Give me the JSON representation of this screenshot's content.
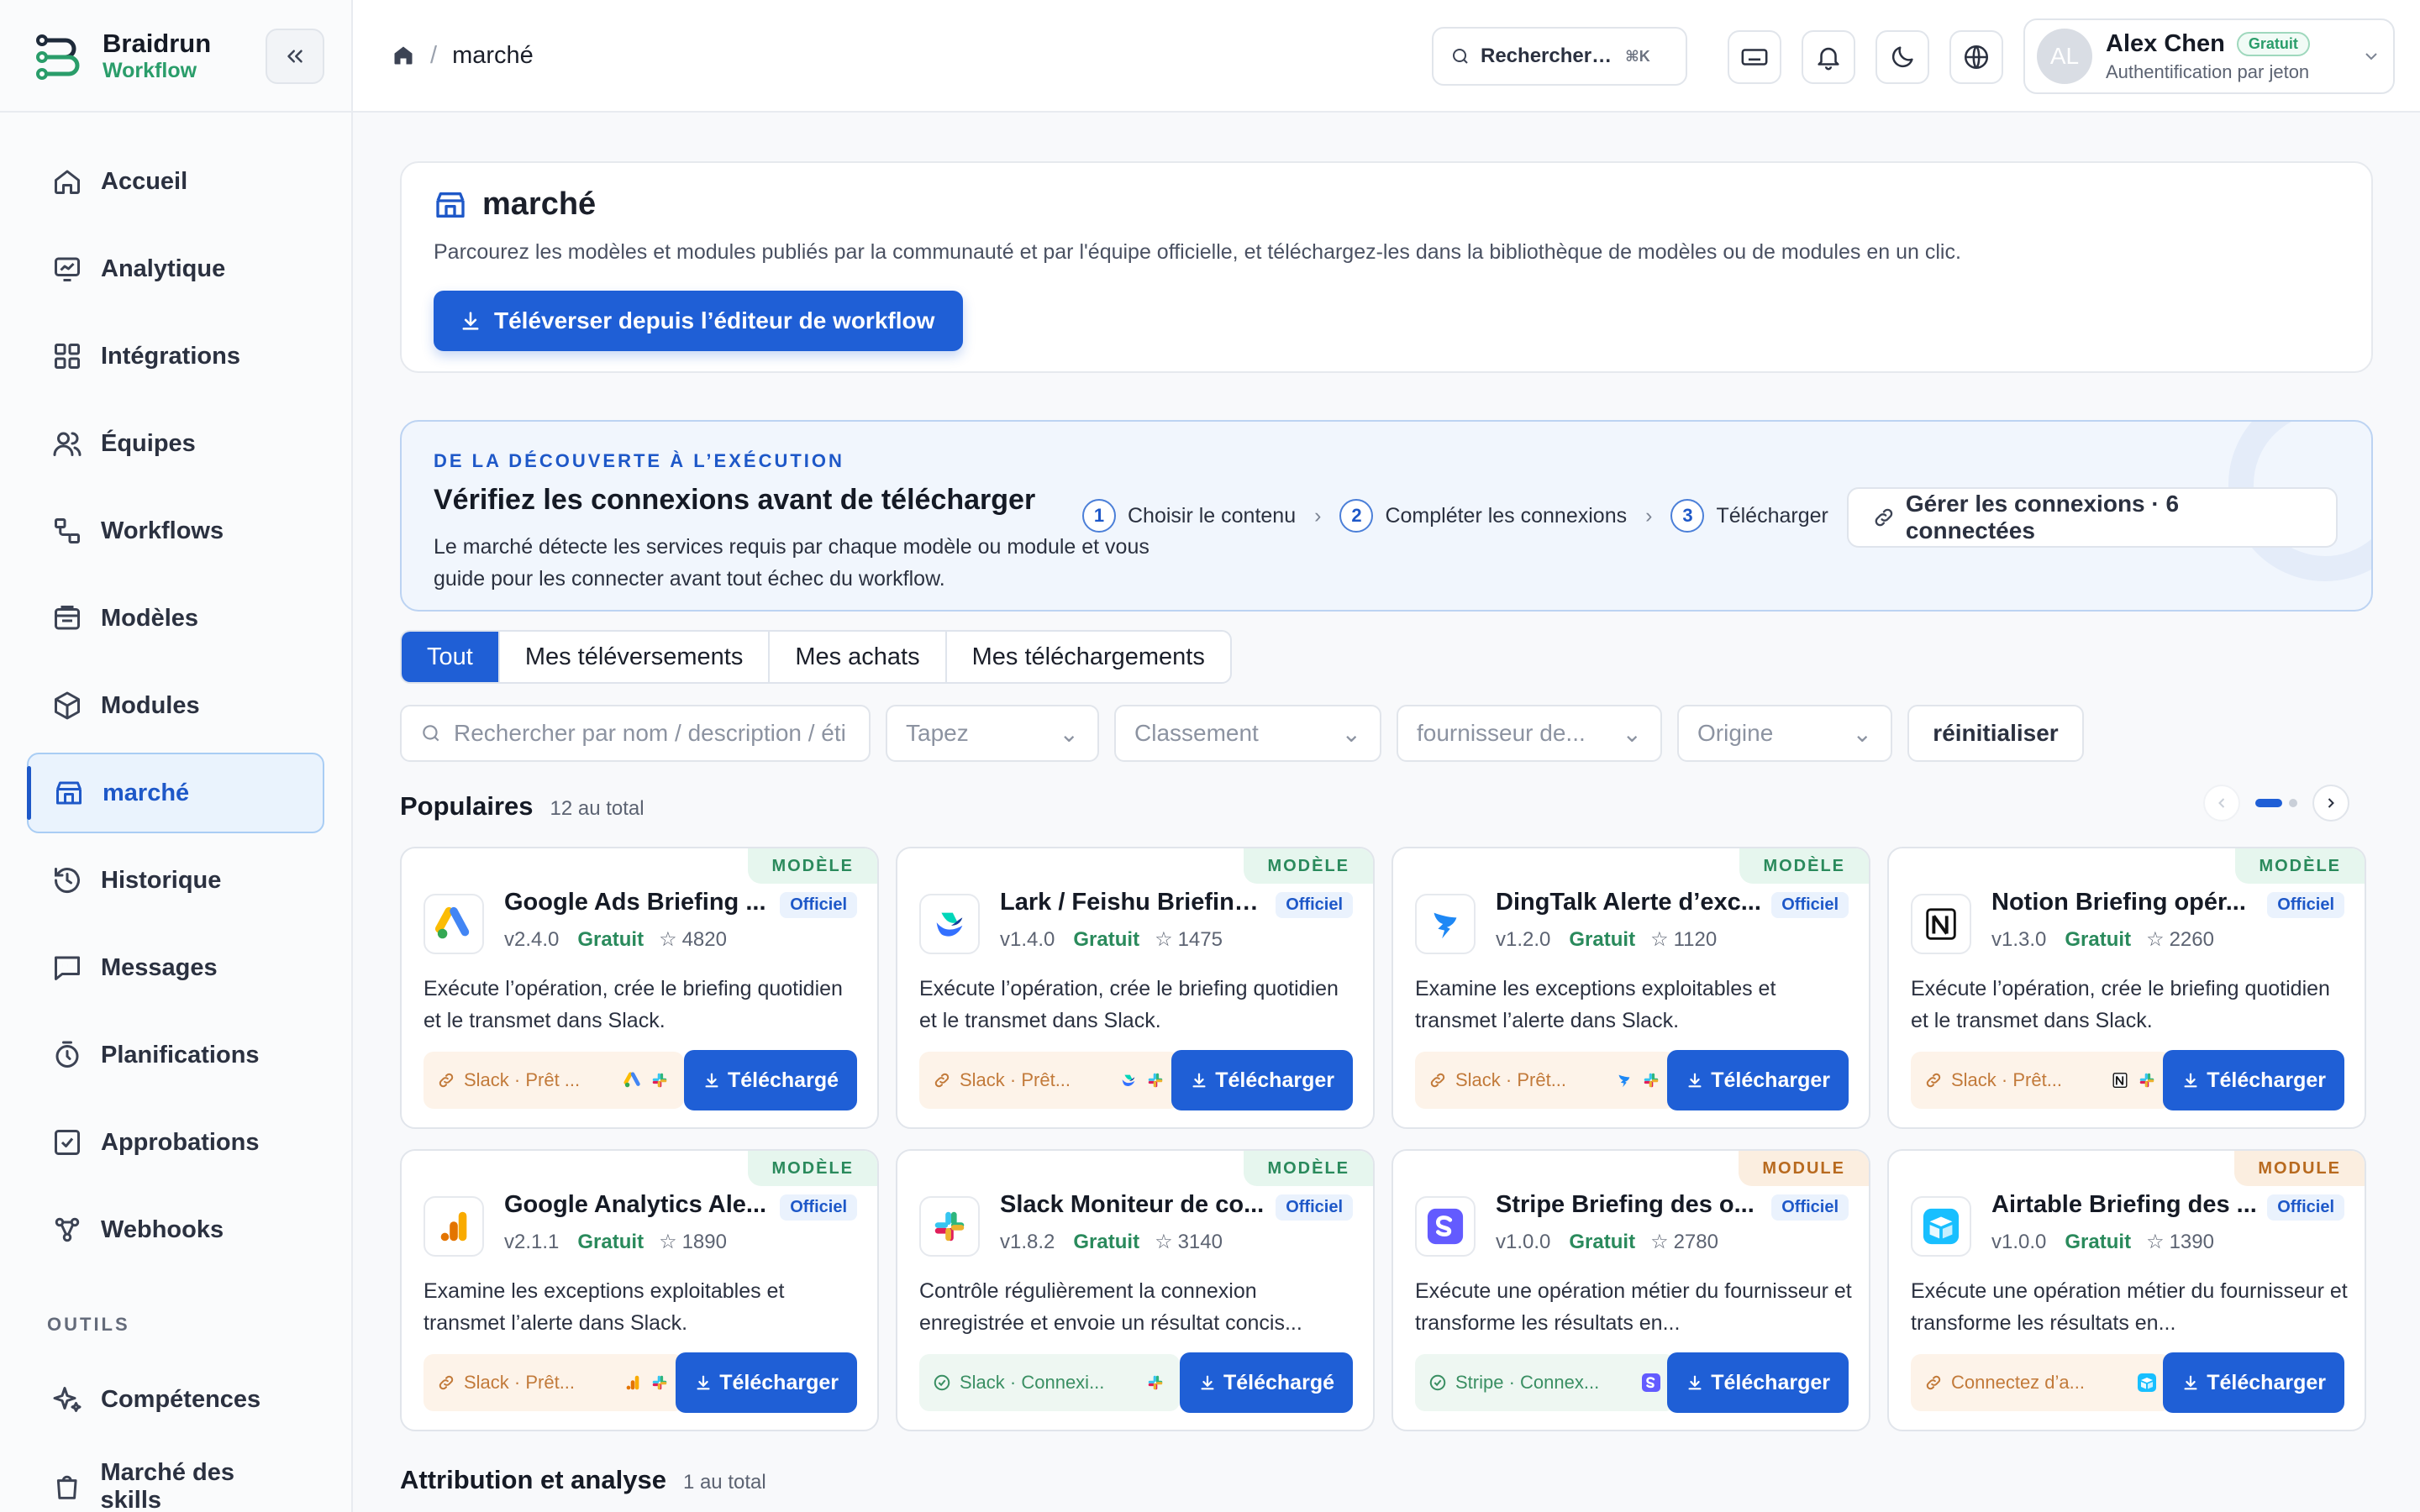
{
  "brand": {
    "name": "Braidrun",
    "sub": "Workflow"
  },
  "nav": {
    "items": [
      {
        "label": "Accueil",
        "icon": "home-icon"
      },
      {
        "label": "Analytique",
        "icon": "chart-icon"
      },
      {
        "label": "Intégrations",
        "icon": "grid-icon"
      },
      {
        "label": "Équipes",
        "icon": "users-icon"
      },
      {
        "label": "Workflows",
        "icon": "workflow-icon"
      },
      {
        "label": "Modèles",
        "icon": "template-icon"
      },
      {
        "label": "Modules",
        "icon": "cube-icon"
      },
      {
        "label": "marché",
        "icon": "store-icon",
        "active": true
      },
      {
        "label": "Historique",
        "icon": "history-icon"
      },
      {
        "label": "Messages",
        "icon": "message-icon"
      },
      {
        "label": "Planifications",
        "icon": "timer-icon"
      },
      {
        "label": "Approbations",
        "icon": "check-square-icon"
      },
      {
        "label": "Webhooks",
        "icon": "webhook-icon"
      }
    ],
    "tools_section": "OUTILS",
    "tools": [
      {
        "label": "Compétences",
        "icon": "sparkle-icon"
      },
      {
        "label": "Marché des skills",
        "icon": "bag-icon"
      }
    ]
  },
  "header": {
    "breadcrumb_sep": "/",
    "breadcrumb_current": "marché",
    "search_placeholder": "Rechercher…",
    "search_kbd": "⌘K",
    "user": {
      "initials": "AL",
      "name": "Alex Chen",
      "plan": "Gratuit",
      "auth": "Authentification par jeton"
    }
  },
  "hero": {
    "title": "marché",
    "description": "Parcourez les modèles et modules publiés par la communauté et par l'équipe officielle, et téléchargez-les dans la bibliothèque de modèles ou de modules en un clic.",
    "upload_label": "Téléverser depuis l’éditeur de workflow"
  },
  "flow": {
    "eyebrow": "DE LA DÉCOUVERTE À L’EXÉCUTION",
    "title": "Vérifiez les connexions avant de télécharger",
    "description": "Le marché détecte les services requis par chaque modèle ou module et vous guide pour les connecter avant tout échec du workflow.",
    "steps": [
      {
        "num": "1",
        "label": "Choisir le contenu"
      },
      {
        "num": "2",
        "label": "Compléter les connexions"
      },
      {
        "num": "3",
        "label": "Télécharger"
      }
    ],
    "manage_label": "Gérer les connexions · 6 connectées"
  },
  "tabs": [
    "Tout",
    "Mes téléversements",
    "Mes achats",
    "Mes téléchargements"
  ],
  "filters": {
    "search_placeholder": "Rechercher par nom / description / éti",
    "type": "Tapez",
    "sort": "Classement",
    "provider": "fournisseur de...",
    "origin": "Origine",
    "reset": "réinitialiser"
  },
  "popular": {
    "title": "Populaires",
    "count": "12 au total",
    "cards": [
      {
        "kind": "MODÈLE",
        "title": "Google Ads Briefing ...",
        "badge": "Officiel",
        "version": "v2.4.0",
        "price": "Gratuit",
        "stars": "4820",
        "desc": "Exécute l’opération, crée le briefing quotidien et le transmet dans Slack.",
        "chip": "Slack · Prêt ...",
        "chip_state": "warn",
        "action": "Téléchargé",
        "logo": "google-ads-logo"
      },
      {
        "kind": "MODÈLE",
        "title": "Lark / Feishu Briefing...",
        "badge": "Officiel",
        "version": "v1.4.0",
        "price": "Gratuit",
        "stars": "1475",
        "desc": "Exécute l’opération, crée le briefing quotidien et le transmet dans Slack.",
        "chip": "Slack · Prêt...",
        "chip_state": "warn",
        "action": "Télécharger",
        "logo": "lark-logo"
      },
      {
        "kind": "MODÈLE",
        "title": "DingTalk Alerte d’exc...",
        "badge": "Officiel",
        "version": "v1.2.0",
        "price": "Gratuit",
        "stars": "1120",
        "desc": "Examine les exceptions exploitables et transmet l’alerte dans Slack.",
        "chip": "Slack · Prêt...",
        "chip_state": "warn",
        "action": "Télécharger",
        "logo": "dingtalk-logo"
      },
      {
        "kind": "MODÈLE",
        "title": "Notion Briefing opér...",
        "badge": "Officiel",
        "version": "v1.3.0",
        "price": "Gratuit",
        "stars": "2260",
        "desc": "Exécute l’opération, crée le briefing quotidien et le transmet dans Slack.",
        "chip": "Slack · Prêt...",
        "chip_state": "warn",
        "action": "Télécharger",
        "logo": "notion-logo"
      },
      {
        "kind": "MODÈLE",
        "title": "Google Analytics Ale...",
        "badge": "Officiel",
        "version": "v2.1.1",
        "price": "Gratuit",
        "stars": "1890",
        "desc": "Examine les exceptions exploitables et transmet l’alerte dans Slack.",
        "chip": "Slack · Prêt...",
        "chip_state": "warn",
        "action": "Télécharger",
        "logo": "google-analytics-logo"
      },
      {
        "kind": "MODÈLE",
        "title": "Slack Moniteur de co...",
        "badge": "Officiel",
        "version": "v1.8.2",
        "price": "Gratuit",
        "stars": "3140",
        "desc": "Contrôle régulièrement la connexion enregistrée et envoie un résultat concis...",
        "chip": "Slack · Connexi...",
        "chip_state": "ok",
        "action": "Téléchargé",
        "logo": "slack-logo"
      },
      {
        "kind": "MODULE",
        "title": "Stripe Briefing des o...",
        "badge": "Officiel",
        "version": "v1.0.0",
        "price": "Gratuit",
        "stars": "2780",
        "desc": "Exécute une opération métier du fournisseur et transforme les résultats en...",
        "chip": "Stripe · Connex...",
        "chip_state": "ok",
        "action": "Télécharger",
        "logo": "stripe-logo"
      },
      {
        "kind": "MODULE",
        "title": "Airtable Briefing des ...",
        "badge": "Officiel",
        "version": "v1.0.0",
        "price": "Gratuit",
        "stars": "1390",
        "desc": "Exécute une opération métier du fournisseur et transforme les résultats en...",
        "chip": "Connectez d’a...",
        "chip_state": "warn",
        "action": "Télécharger",
        "logo": "airtable-logo"
      }
    ]
  },
  "attribution": {
    "title": "Attribution et analyse",
    "count": "1 au total"
  },
  "colors": {
    "primary": "#1f5fd6",
    "brand_green": "#2a9d6a",
    "modele": "#2a8a5c",
    "module": "#b86a1f"
  }
}
